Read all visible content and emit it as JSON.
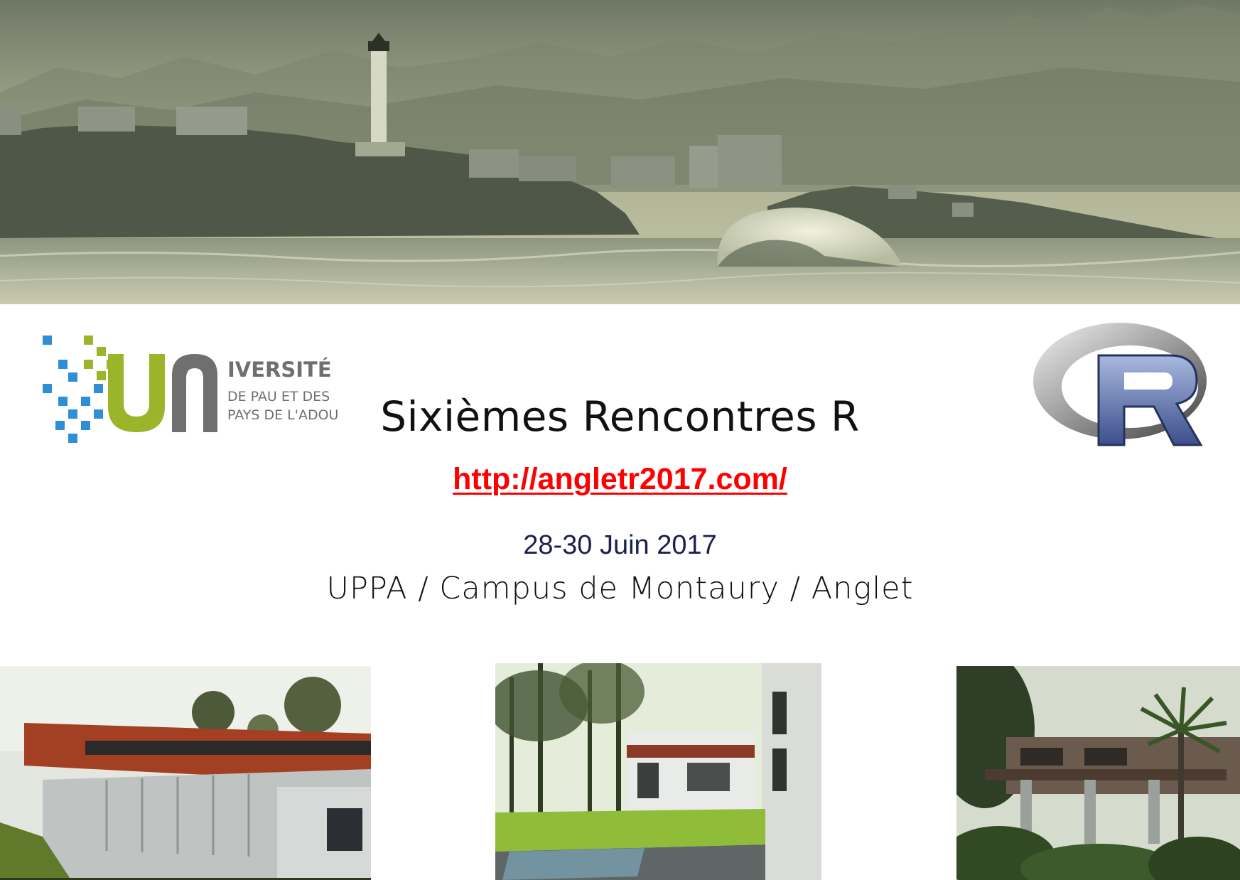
{
  "event": {
    "title": "Sixièmes Rencontres R",
    "url": "http://angletr2017.com/",
    "dates": "28-30 Juin 2017",
    "location": "UPPA / Campus de Montaury / Anglet"
  },
  "university_logo": {
    "line1": "IVERSITÉ",
    "line2": "DE PAU ET DES",
    "line3": "PAYS DE L'ADOUR"
  },
  "r_logo": {
    "letter": "R"
  },
  "colors": {
    "title": "#111111",
    "link": "#ff0000",
    "dates": "#1a1f4e",
    "uppa_green": "#9ab52a",
    "uppa_blue": "#2f8fd6",
    "uppa_gray": "#6f6f6f",
    "r_blue": "#5a6fa8",
    "hero_tint": "#9ea58a"
  },
  "images": {
    "hero": "biarritz-lighthouse-coast-wave",
    "photo_1": "red-building-campus",
    "photo_2": "campus-lawn-trees",
    "photo_3": "pergola-palm-garden"
  }
}
